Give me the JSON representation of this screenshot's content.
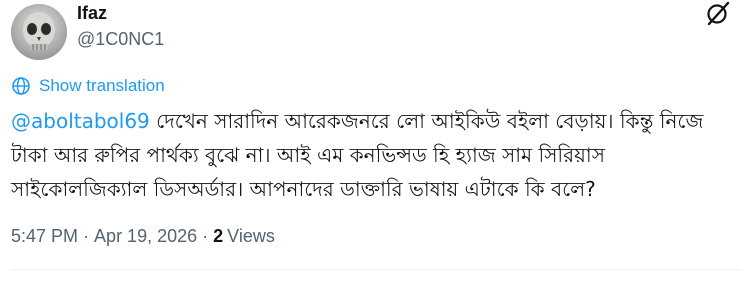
{
  "author": {
    "display_name": "Ifaz",
    "handle": "@1C0NC1"
  },
  "translation": {
    "label": "Show translation"
  },
  "tweet": {
    "mention": "@aboltabol69",
    "text": " দেখেন সারাদিন আরেকজনরে লো আইকিউ বইলা বেড়ায়। কিন্তু নিজে টাকা আর রুপির পার্থক্য বুঝে না। আই এম কনভিন্সড হি হ্যাজ সাম সিরিয়াস সাইকোলজিক্যাল ডিসঅর্ডার। আপনাদের ডাক্তারি ভাষায় এটাকে কি বলে?"
  },
  "meta": {
    "time": "5:47 PM",
    "separator1": "·",
    "date": "Apr 19, 2026",
    "separator2": "·",
    "views_count": "2",
    "views_label": "Views"
  },
  "colors": {
    "link": "#1d9bf0",
    "secondary_text": "#536471",
    "primary_text": "#0f1419"
  },
  "icons": {
    "grok": "grok-icon",
    "translate": "globe-icon"
  }
}
